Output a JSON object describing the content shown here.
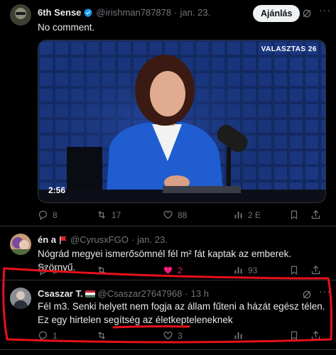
{
  "post1": {
    "name": "6th Sense",
    "handle": "@irishman787878",
    "dot": "·",
    "time": "jan. 23.",
    "follow_label": "Ajánlás",
    "text": "No comment.",
    "video": {
      "watermark": "VALASZTAS 26",
      "duration": "2:56"
    },
    "actions": {
      "replies": "8",
      "reposts": "17",
      "likes": "88",
      "views": "2 E"
    }
  },
  "post2": {
    "name": "én a",
    "handle": "@CyrusxFGO",
    "dot": "·",
    "time": "jan. 23.",
    "text": "Nógrád megyei ismerősömnél fél m² fát kaptak az emberek. Szörnyű.",
    "actions": {
      "replies": "2",
      "reposts": "",
      "likes": "2",
      "views": "93"
    }
  },
  "post3": {
    "name": "Csaszar T.",
    "handle": "@Csaszar27647968",
    "dot": "·",
    "time": "13 h",
    "text": "Fél m3. Senki helyett nem fogja az állam fűteni a házát egész télen. Ez egy hirtelen segítség az életkepteleneknek",
    "actions": {
      "replies": "1",
      "reposts": "",
      "likes": "3",
      "views": ""
    }
  },
  "colors": {
    "accent_blue": "#1d9bf0",
    "like_pink": "#f91880",
    "annotation_red": "#e8101a",
    "muted": "#71767b"
  }
}
